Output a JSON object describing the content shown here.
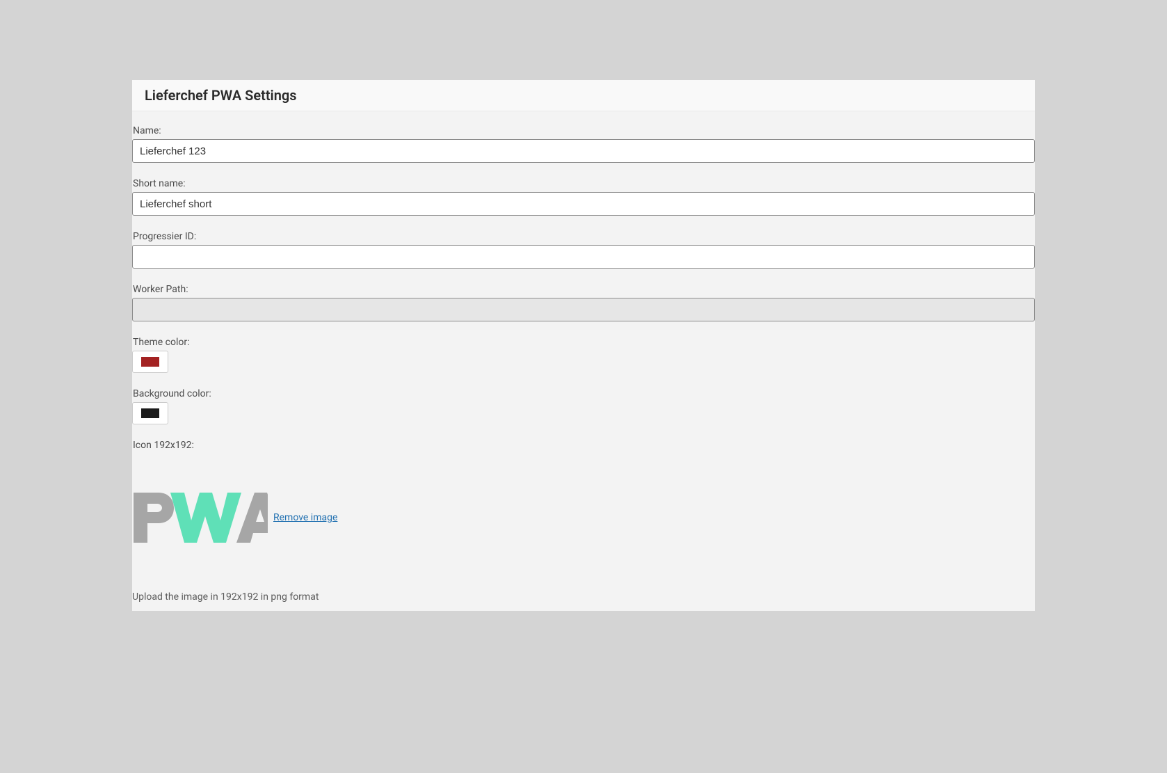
{
  "panel": {
    "title": "Lieferchef PWA Settings"
  },
  "fields": {
    "name": {
      "label": "Name:",
      "value": "Lieferchef 123"
    },
    "short_name": {
      "label": "Short name:",
      "value": "Lieferchef short"
    },
    "progressier_id": {
      "label": "Progressier ID:",
      "value": ""
    },
    "worker_path": {
      "label": "Worker Path:",
      "value": ""
    },
    "theme_color": {
      "label": "Theme color:",
      "value": "#a32222"
    },
    "background_color": {
      "label": "Background color:",
      "value": "#1a1a1a"
    },
    "icon_192": {
      "label": "Icon 192x192:",
      "remove_label": " Remove image",
      "helper": "Upload the image in 192x192 in png format"
    }
  }
}
